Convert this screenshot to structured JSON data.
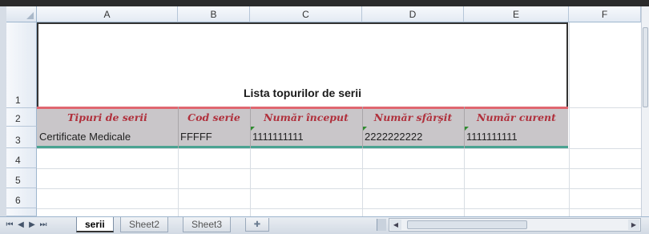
{
  "columns": [
    "A",
    "B",
    "C",
    "D",
    "E",
    "F"
  ],
  "rows": [
    "1",
    "2",
    "3",
    "4",
    "5",
    "6"
  ],
  "title": "Lista topurilor de serii",
  "headers": [
    "Tipuri de serii",
    "Cod serie",
    "Număr început",
    "Număr sfârşit",
    "Număr curent"
  ],
  "data_row": [
    "Certificate Medicale",
    "FFFFF",
    "1111111111",
    "2222222222",
    "1111111111"
  ],
  "sheets": [
    "serii",
    "Sheet2",
    "Sheet3"
  ],
  "nav": [
    "⏮",
    "◀",
    "▶",
    "⏭"
  ],
  "colors": {
    "header_text": "#b0303c",
    "header_band": "#c9c6c9",
    "header_border": "#e06670",
    "data_border": "#4aa391"
  }
}
